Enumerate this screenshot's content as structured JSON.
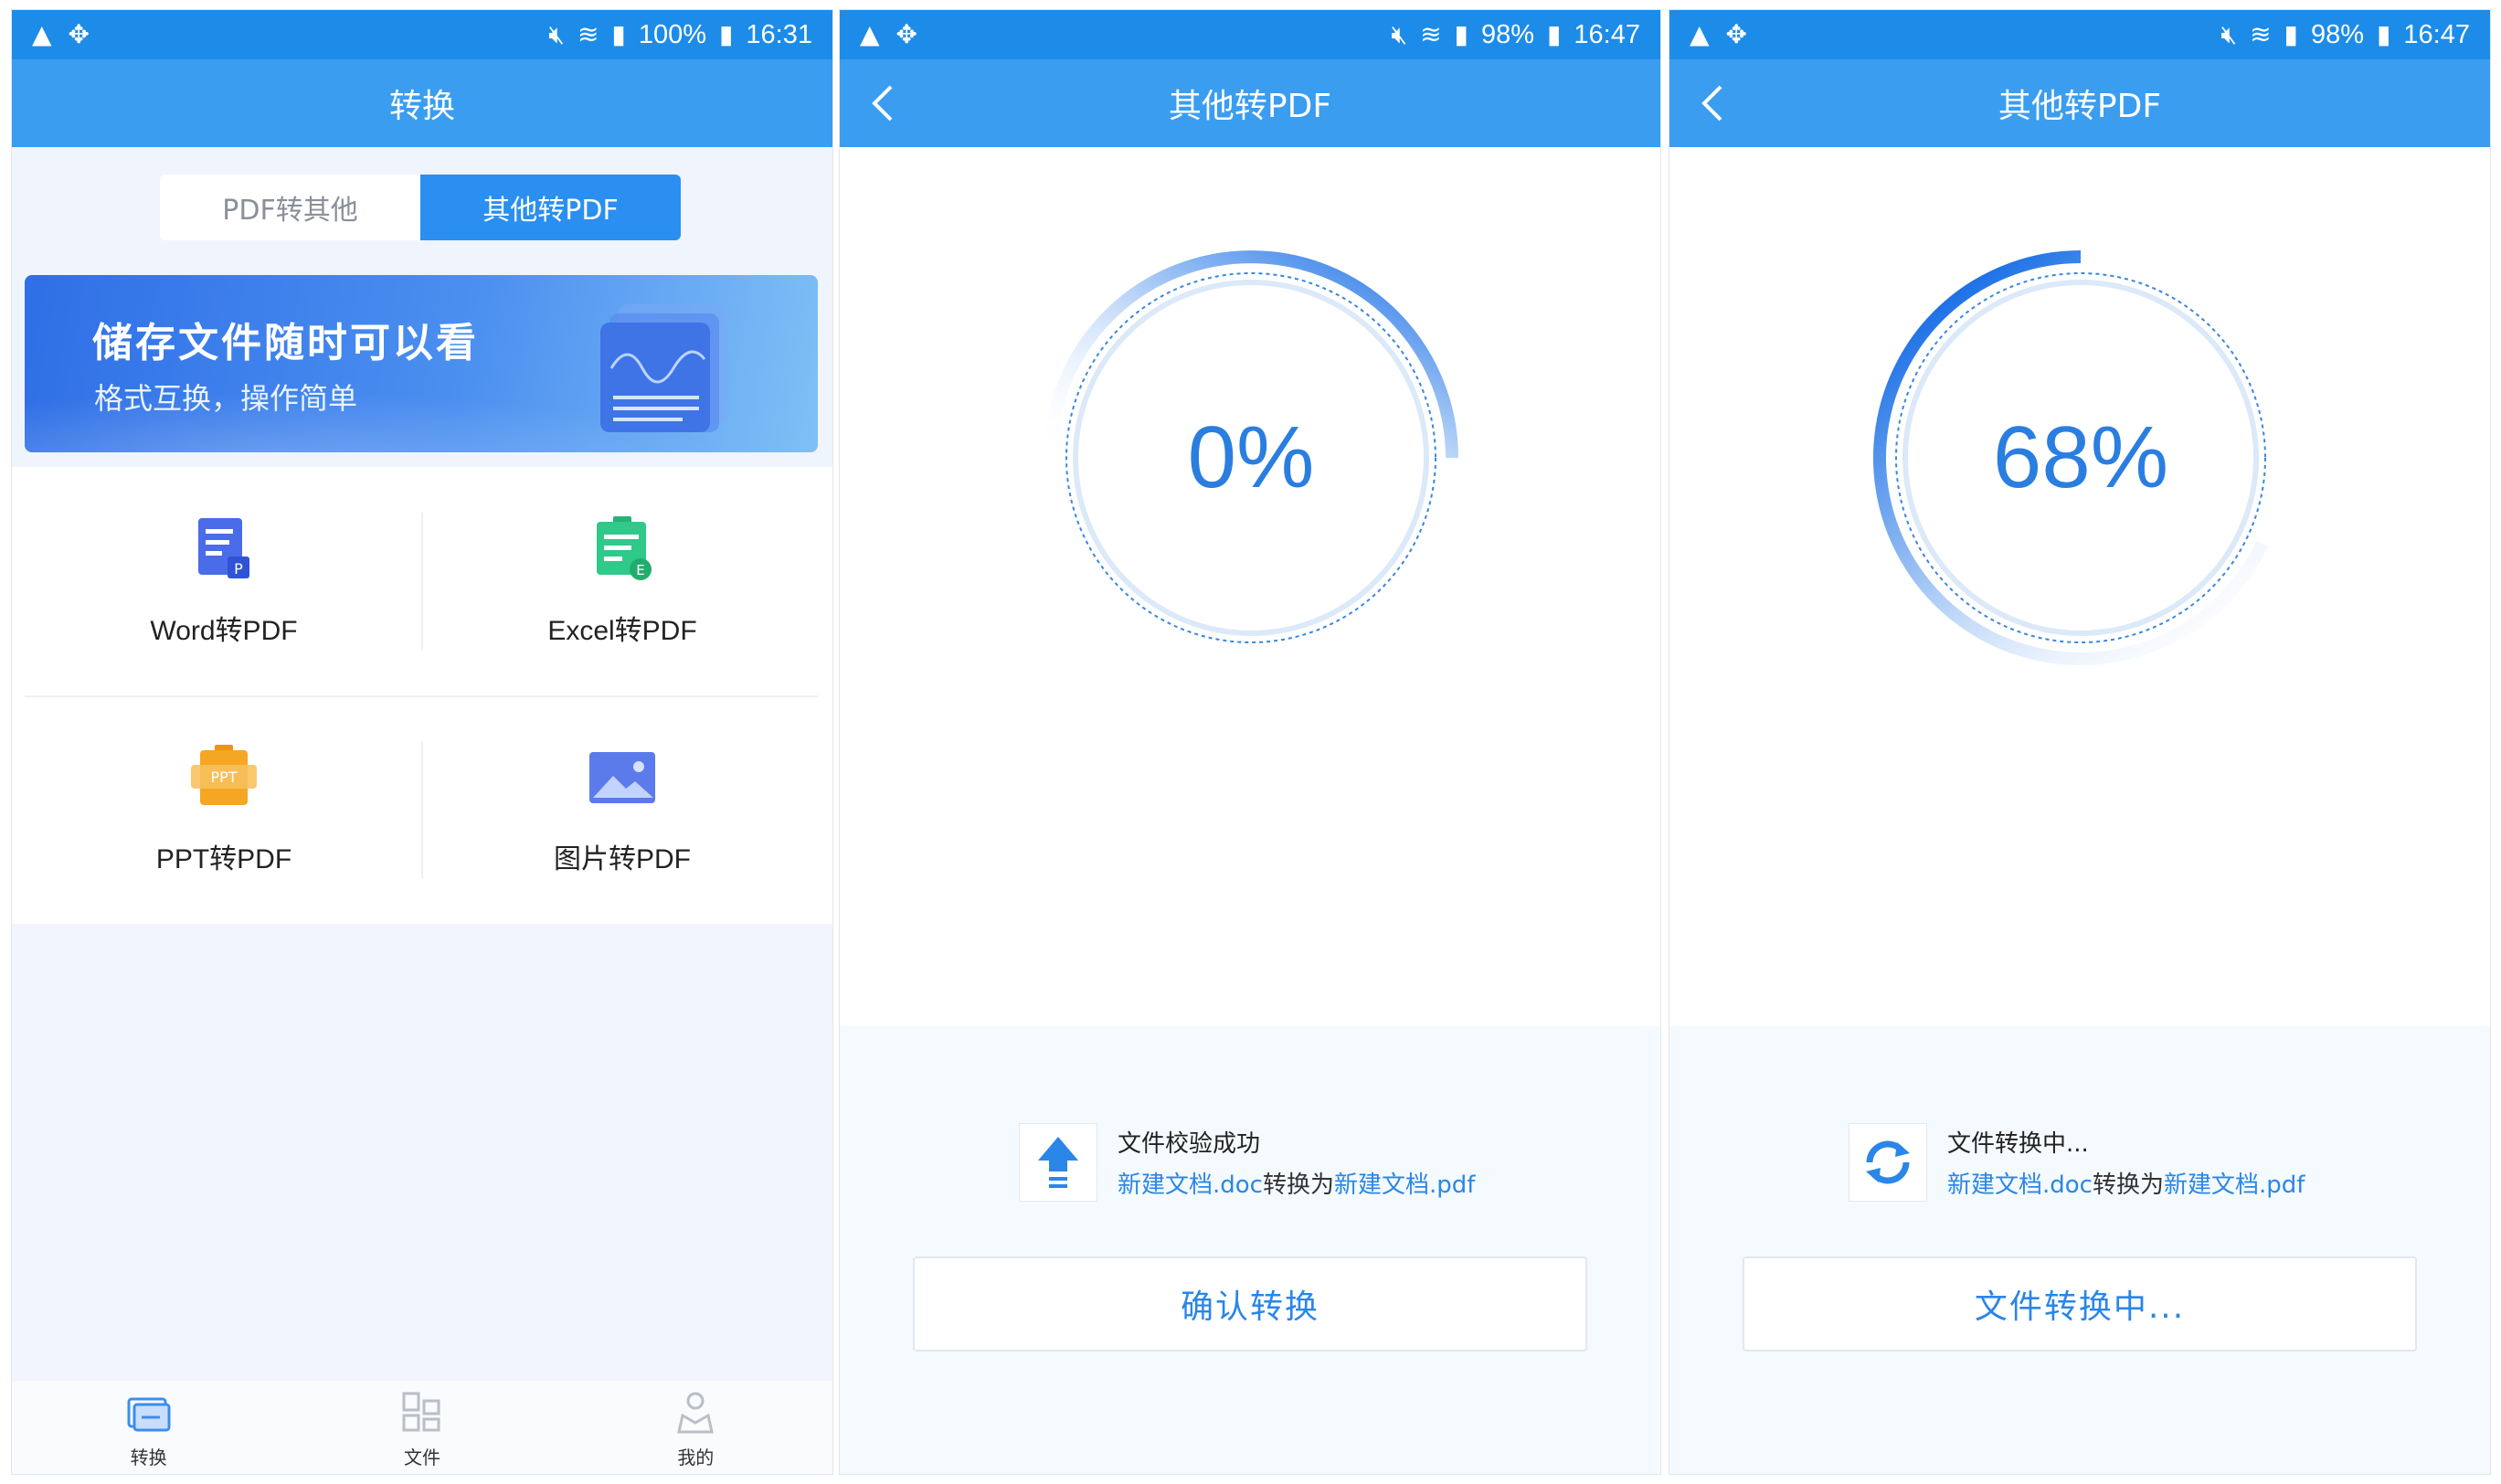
{
  "screens": [
    {
      "status": {
        "battery": "100%",
        "time": "16:31"
      },
      "title": "转换",
      "segment": {
        "left": "PDF转其他",
        "right": "其他转PDF"
      },
      "banner": {
        "title": "储存文件随时可以看",
        "subtitle": "格式互换，操作简单"
      },
      "items": [
        {
          "label": "Word转PDF",
          "icon": "word-doc-icon",
          "color": "#4a6ce8"
        },
        {
          "label": "Excel转PDF",
          "icon": "excel-doc-icon",
          "color": "#2fc98a"
        },
        {
          "label": "PPT转PDF",
          "icon": "ppt-doc-icon",
          "color": "#f5a623"
        },
        {
          "label": "图片转PDF",
          "icon": "image-doc-icon",
          "color": "#5b7bea"
        }
      ],
      "tabs": [
        {
          "label": "转换",
          "icon": "convert-folder-icon",
          "active": true
        },
        {
          "label": "文件",
          "icon": "files-grid-icon",
          "active": false
        },
        {
          "label": "我的",
          "icon": "profile-icon",
          "active": false
        }
      ]
    },
    {
      "status": {
        "battery": "98%",
        "time": "16:47"
      },
      "title": "其他转PDF",
      "progress": {
        "percent_label": "0%"
      },
      "file": {
        "status": "文件校验成功",
        "source": "新建文档.doc",
        "middle": "转换为",
        "target": "新建文档.pdf",
        "icon": "upload-arrow-icon"
      },
      "button": "确认转换"
    },
    {
      "status": {
        "battery": "98%",
        "time": "16:47"
      },
      "title": "其他转PDF",
      "progress": {
        "percent_label": "68%",
        "value": 0.68
      },
      "file": {
        "status": "文件转换中...",
        "source": "新建文档.doc",
        "middle": "转换为",
        "target": "新建文档.pdf",
        "icon": "refresh-icon"
      },
      "button": "文件转换中..."
    }
  ],
  "colors": {
    "statusbar": "#1d8ce8",
    "appbar": "#3a9df0",
    "accent": "#2a86e8"
  }
}
